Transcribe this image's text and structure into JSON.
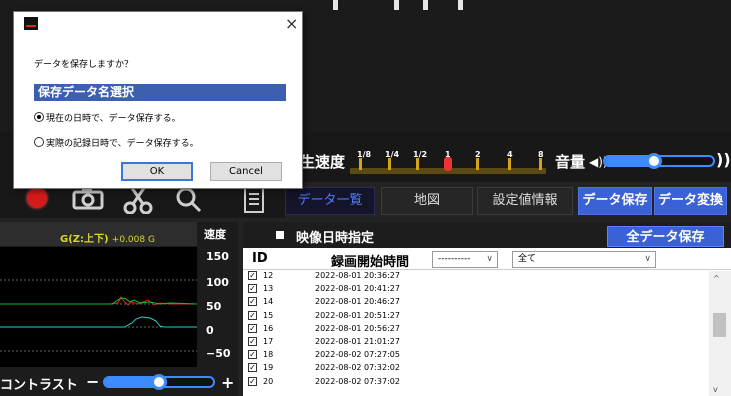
{
  "dialog": {
    "question": "データを保存しますか？",
    "section_title": "保存データ名選択",
    "options": [
      {
        "label": "現在の日時で、データ保存する。",
        "selected": true
      },
      {
        "label": "実際の記録日時で、データ保存する。",
        "selected": false
      }
    ],
    "ok_label": "OK",
    "cancel_label": "Cancel",
    "close_glyph": "×"
  },
  "playback": {
    "speed_label": "生速度",
    "speed_marks": [
      "1/8",
      "1/4",
      "1/2",
      "1",
      "2",
      "4",
      "8"
    ],
    "speed_selected": "1",
    "volume_label": "音量",
    "volume_icon": "speaker-icon",
    "volume_max_icon": "loud-speaker-icon",
    "volume_icon_glyph": "◀))",
    "volume_max_glyph": "))",
    "volume_level": 0.45
  },
  "toolbar": {
    "icons": [
      "record-icon",
      "camera-icon",
      "scissors-icon",
      "search-icon",
      "document-icon"
    ]
  },
  "tabs": [
    {
      "label": "データ一覧",
      "active": true
    },
    {
      "label": "地図",
      "active": false
    },
    {
      "label": "設定値情報",
      "active": false
    },
    {
      "label": "データ保存",
      "active": false
    },
    {
      "label": "データ変換",
      "active": false
    }
  ],
  "graph": {
    "title": "G(Z:上下)",
    "value": "+0.008 G",
    "speed_axis_title": "速度",
    "speed_axis": [
      "150",
      "100",
      "50",
      "0",
      "−50"
    ],
    "contrast_label": "コントラスト",
    "contrast_minus": "−",
    "contrast_plus": "+",
    "contrast_level": 0.5
  },
  "data_list": {
    "date_spec_label": "映像日時指定",
    "save_all_label": "全データ保存",
    "col_id": "ID",
    "col_start": "録画開始時間",
    "filter1": "----------",
    "filter2": "全て",
    "rows": [
      {
        "id": "12",
        "start": "2022-08-01 20:36:27",
        "checked": true
      },
      {
        "id": "13",
        "start": "2022-08-01 20:41:27",
        "checked": true
      },
      {
        "id": "14",
        "start": "2022-08-01 20:46:27",
        "checked": true
      },
      {
        "id": "15",
        "start": "2022-08-01 20:51:27",
        "checked": true
      },
      {
        "id": "16",
        "start": "2022-08-01 20:56:27",
        "checked": true
      },
      {
        "id": "17",
        "start": "2022-08-01 21:01:27",
        "checked": true
      },
      {
        "id": "18",
        "start": "2022-08-02 07:27:05",
        "checked": true
      },
      {
        "id": "19",
        "start": "2022-08-02 07:32:02",
        "checked": true
      },
      {
        "id": "20",
        "start": "2022-08-02 07:37:02",
        "checked": true
      }
    ]
  },
  "colors": {
    "accent": "#3a62d6",
    "slider": "#3c8cff",
    "record": "#d21b1b",
    "graph_title": "#d7d72a"
  }
}
